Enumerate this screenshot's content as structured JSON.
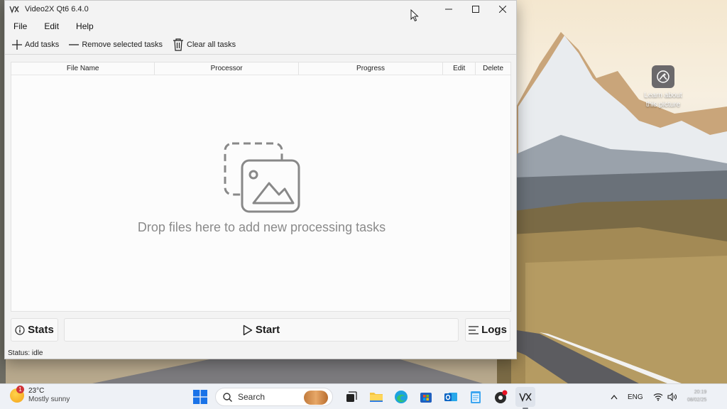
{
  "window": {
    "title": "Video2X Qt6 6.4.0",
    "logo_text": "V",
    "controls": [
      "minimize",
      "maximize",
      "close"
    ]
  },
  "menu": [
    {
      "label": "File"
    },
    {
      "label": "Edit"
    },
    {
      "label": "Help"
    }
  ],
  "toolbar": {
    "add_tasks": "Add tasks",
    "remove_selected": "Remove selected tasks",
    "clear_all": "Clear all tasks"
  },
  "table": {
    "columns": [
      "File Name",
      "Processor",
      "Progress",
      "Edit",
      "Delete"
    ]
  },
  "drop_zone": {
    "text": "Drop files here to add new processing tasks",
    "icon": "images-icon"
  },
  "buttons": {
    "stats": "Stats",
    "start": "Start",
    "logs": "Logs"
  },
  "status": {
    "text": "Status: idle"
  },
  "desktop": {
    "learn_icon_label": "Learn about this picture"
  },
  "taskbar": {
    "weather_temp": "23°C",
    "weather_desc": "Mostly sunny",
    "weather_badge": "1",
    "search_placeholder": "Search",
    "language": "ENG",
    "clock_time": "20:19",
    "clock_date": "08/02/25"
  },
  "colors": {
    "window_bg": "#f3f3f3",
    "drop_text": "#8a8a8a",
    "taskbar_bg": "#eef1f6"
  }
}
